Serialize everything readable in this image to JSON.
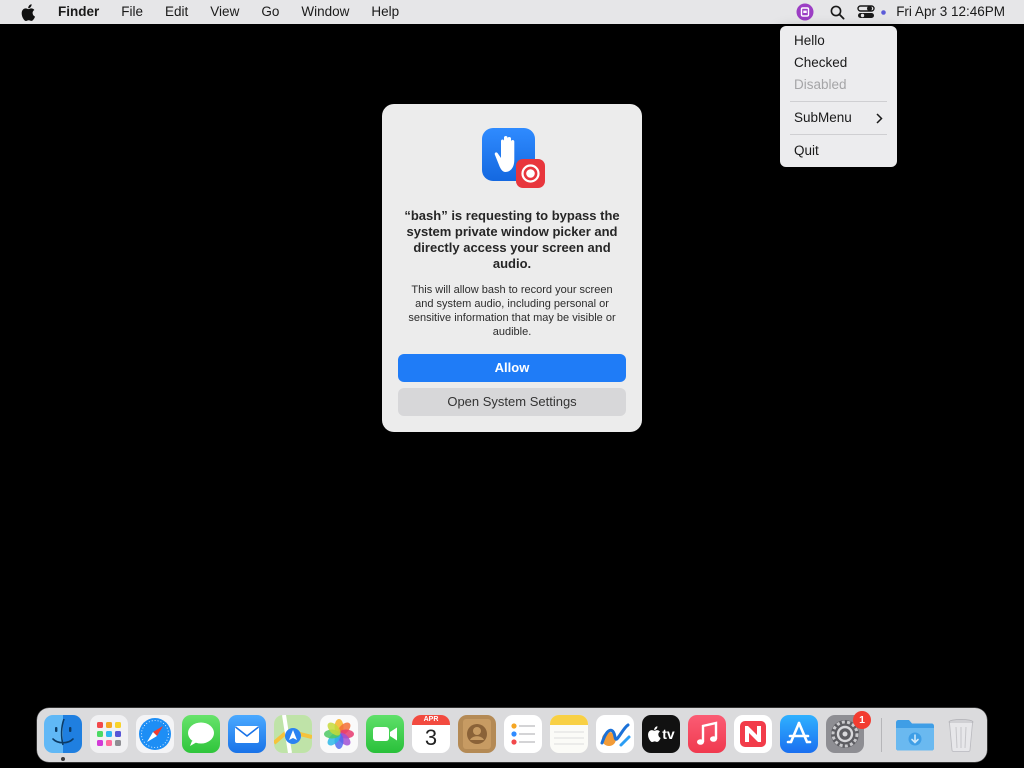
{
  "menubar": {
    "app_name": "Finder",
    "menus": [
      "File",
      "Edit",
      "View",
      "Go",
      "Window",
      "Help"
    ],
    "clock": "Fri Apr 3  12:46PM",
    "status_icons": [
      "app-status-icon",
      "search-icon",
      "control-center-icon"
    ]
  },
  "status_menu": {
    "items": [
      {
        "label": "Hello",
        "enabled": true
      },
      {
        "label": "Checked",
        "enabled": true
      },
      {
        "label": "Disabled",
        "enabled": false
      },
      {
        "label": "SubMenu",
        "enabled": true,
        "submenu": true
      },
      {
        "label": "Quit",
        "enabled": true
      }
    ]
  },
  "dialog": {
    "title": "“bash” is requesting to bypass the system private window picker and directly access your screen and audio.",
    "body": "This will allow bash to record your screen and system audio, including personal or sensitive information that may be visible or audible.",
    "allow_label": "Allow",
    "settings_label": "Open System Settings",
    "icon": "privacy-hand-screen-record-icon"
  },
  "dock": {
    "items": [
      {
        "name": "Finder",
        "icon": "finder-icon",
        "running": true
      },
      {
        "name": "Launchpad",
        "icon": "launchpad-icon"
      },
      {
        "name": "Safari",
        "icon": "safari-icon"
      },
      {
        "name": "Messages",
        "icon": "messages-icon"
      },
      {
        "name": "Mail",
        "icon": "mail-icon"
      },
      {
        "name": "Maps",
        "icon": "maps-icon"
      },
      {
        "name": "Photos",
        "icon": "photos-icon"
      },
      {
        "name": "FaceTime",
        "icon": "facetime-icon"
      },
      {
        "name": "Calendar",
        "icon": "calendar-icon",
        "month": "APR",
        "day": "3"
      },
      {
        "name": "Contacts",
        "icon": "contacts-icon"
      },
      {
        "name": "Reminders",
        "icon": "reminders-icon"
      },
      {
        "name": "Notes",
        "icon": "notes-icon"
      },
      {
        "name": "Freeform",
        "icon": "freeform-icon"
      },
      {
        "name": "TV",
        "icon": "tv-icon",
        "label": "tv"
      },
      {
        "name": "Music",
        "icon": "music-icon"
      },
      {
        "name": "News",
        "icon": "news-icon"
      },
      {
        "name": "App Store",
        "icon": "app-store-icon"
      },
      {
        "name": "System Settings",
        "icon": "system-settings-icon",
        "badge": "1"
      },
      {
        "name": "Downloads",
        "icon": "downloads-folder-icon"
      },
      {
        "name": "Trash",
        "icon": "trash-icon"
      }
    ]
  },
  "colors": {
    "accent": "#1f7cf7",
    "desktop": "#000000",
    "badge": "#f23c30"
  }
}
